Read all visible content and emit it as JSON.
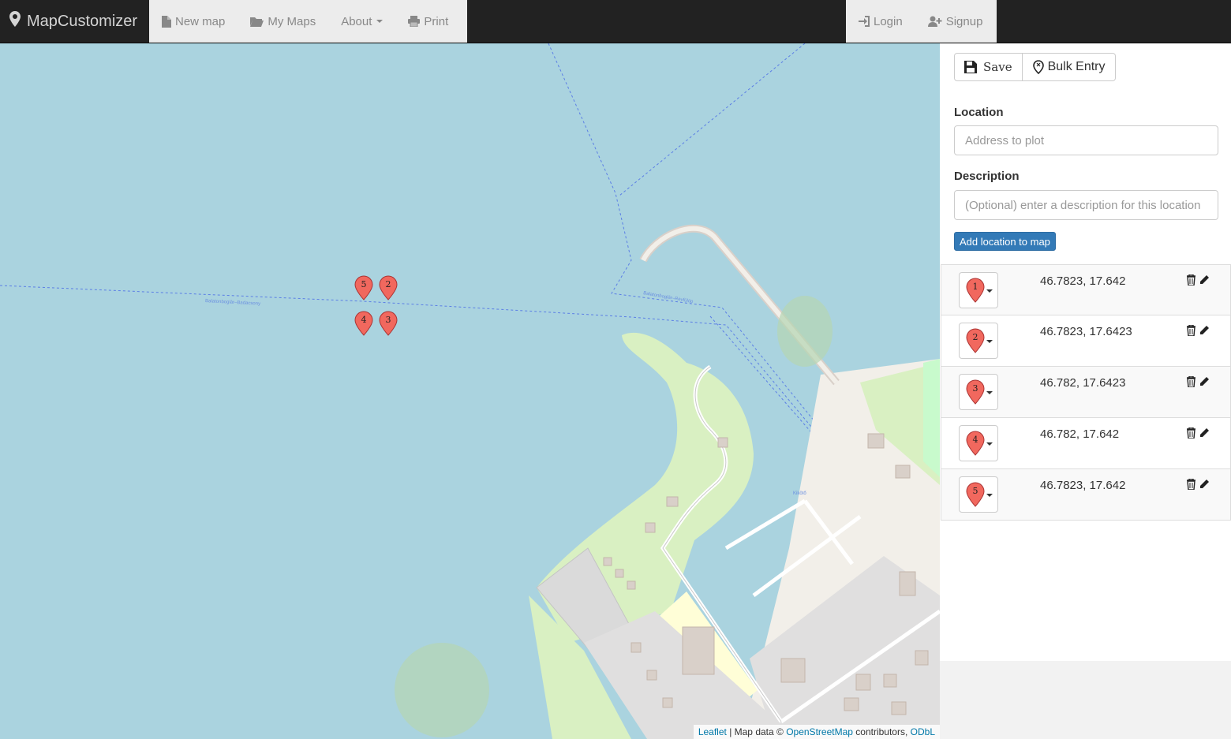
{
  "navbar": {
    "brand": "MapCustomizer",
    "items": [
      {
        "label": "New map",
        "icon": "file-icon"
      },
      {
        "label": "My Maps",
        "icon": "folder-open-icon"
      },
      {
        "label": "About",
        "icon": "caret-down-icon"
      },
      {
        "label": "Print",
        "icon": "print-icon"
      }
    ],
    "right_items": [
      {
        "label": "Login",
        "icon": "login-icon"
      },
      {
        "label": "Signup",
        "icon": "user-plus-icon"
      }
    ]
  },
  "sidebar": {
    "save_label": "Save",
    "bulk_label": "Bulk Entry",
    "location_label": "Location",
    "location_placeholder": "Address to plot",
    "description_label": "Description",
    "description_placeholder": "(Optional) enter a description for this location",
    "add_button": "Add location to map",
    "locations": [
      {
        "number": "1",
        "coords": "46.7823, 17.642"
      },
      {
        "number": "2",
        "coords": "46.7823, 17.6423"
      },
      {
        "number": "3",
        "coords": "46.782, 17.6423"
      },
      {
        "number": "4",
        "coords": "46.782, 17.642"
      },
      {
        "number": "5",
        "coords": "46.7823, 17.642"
      }
    ]
  },
  "map": {
    "markers": [
      "5",
      "2",
      "4",
      "3"
    ],
    "marker_color": "#f1685e",
    "water_color": "#aad3df",
    "park_color": "#d9f0c2",
    "attribution": {
      "leaflet": "Leaflet",
      "sep": "| Map data ©",
      "osm": "OpenStreetMap",
      "contrib": "contributors,",
      "odbl": "ODbL"
    }
  }
}
